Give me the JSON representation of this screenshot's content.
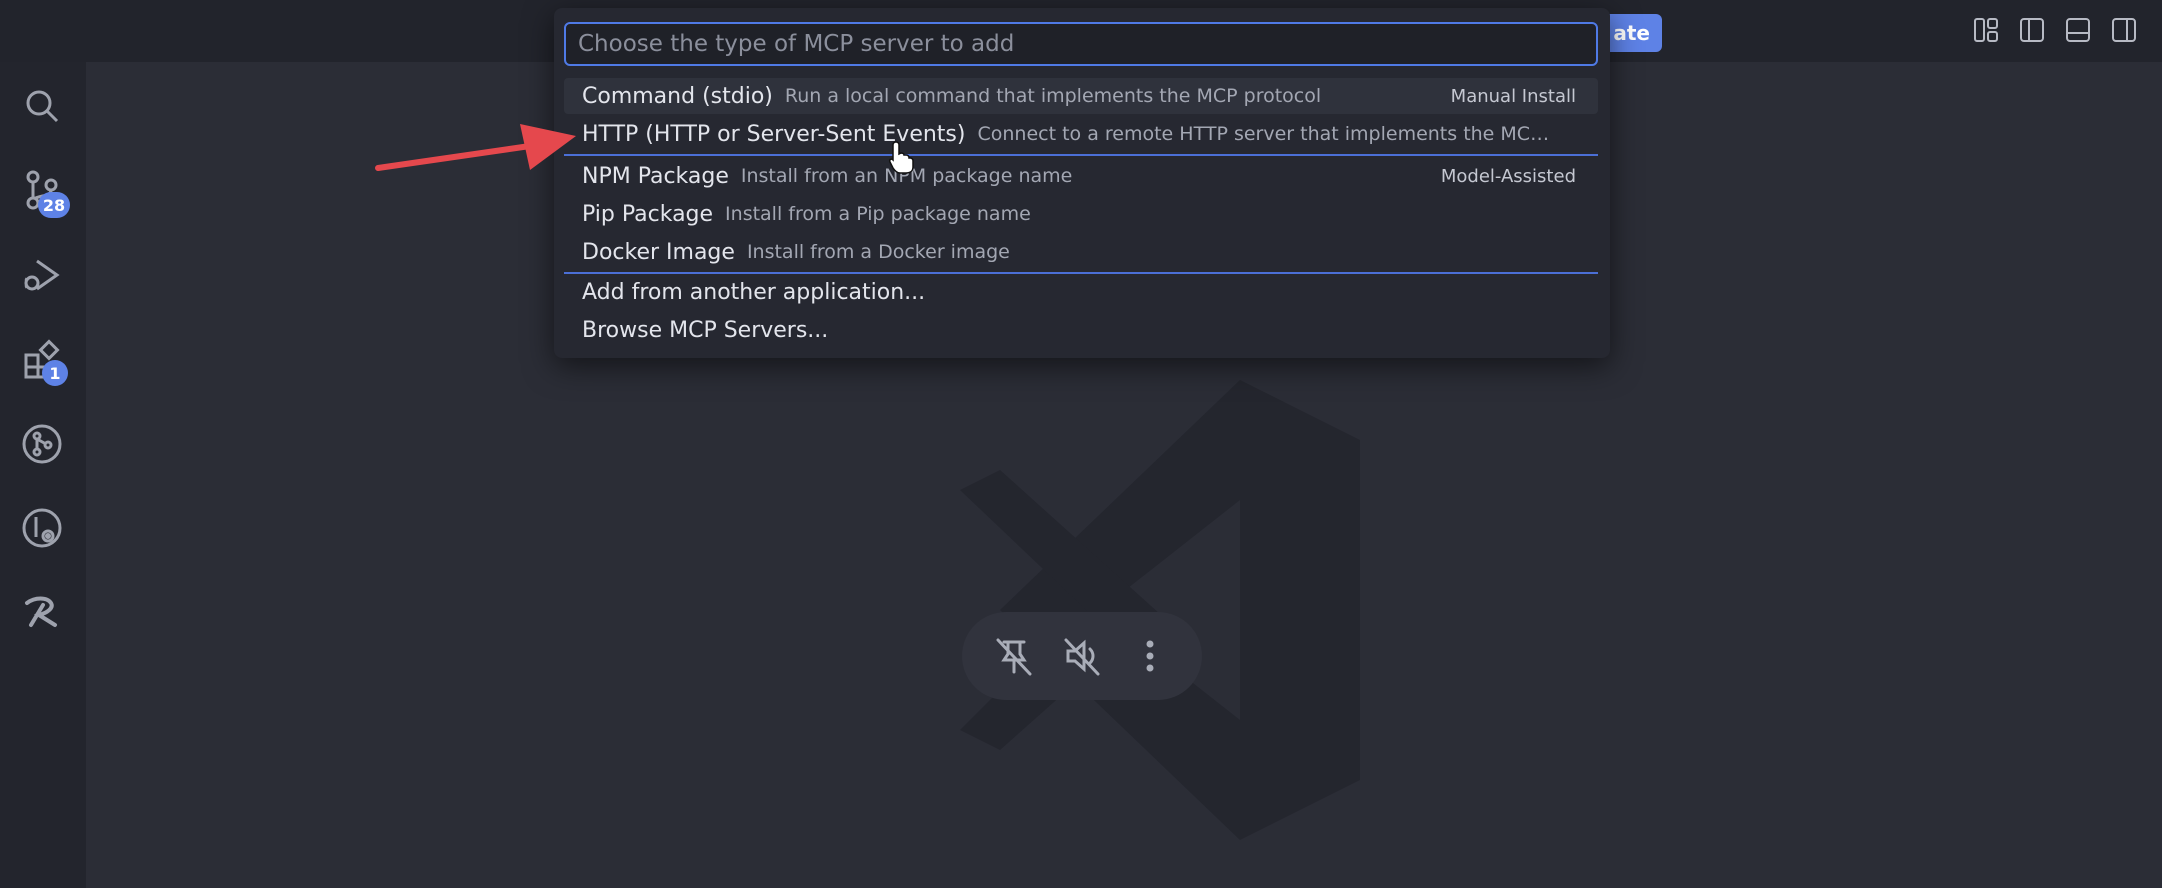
{
  "quick_pick": {
    "placeholder": "Choose the type of MCP server to add",
    "items": [
      {
        "label": "Command (stdio)",
        "description": "Run a local command that implements the MCP protocol",
        "tag": "Manual Install"
      },
      {
        "label": "HTTP (HTTP or Server-Sent Events)",
        "description": "Connect to a remote HTTP server that implements the MC…",
        "tag": ""
      },
      {
        "label": "NPM Package",
        "description": "Install from an NPM package name",
        "tag": "Model-Assisted"
      },
      {
        "label": "Pip Package",
        "description": "Install from a Pip package name",
        "tag": ""
      },
      {
        "label": "Docker Image",
        "description": "Install from a Docker image",
        "tag": ""
      },
      {
        "label": "Add from another application...",
        "description": "",
        "tag": ""
      },
      {
        "label": "Browse MCP Servers...",
        "description": "",
        "tag": ""
      }
    ]
  },
  "titlebar": {
    "update_button_label": "ate"
  },
  "activity_bar": {
    "source_control_badge": "28",
    "extensions_badge": "1",
    "icons": [
      "search-icon",
      "source-control-icon",
      "run-debug-icon",
      "extensions-icon",
      "git-graph-icon",
      "gitlens-icon",
      "ai-assistant-icon"
    ]
  },
  "floating_toolbar": {
    "icons": [
      "unpin-icon",
      "mute-icon",
      "more-vertical-icon"
    ]
  },
  "colors": {
    "accent": "#5e82e6",
    "selection_border": "#4f7ae6",
    "arrow": "#e5484d",
    "background": "#2b2d36"
  }
}
